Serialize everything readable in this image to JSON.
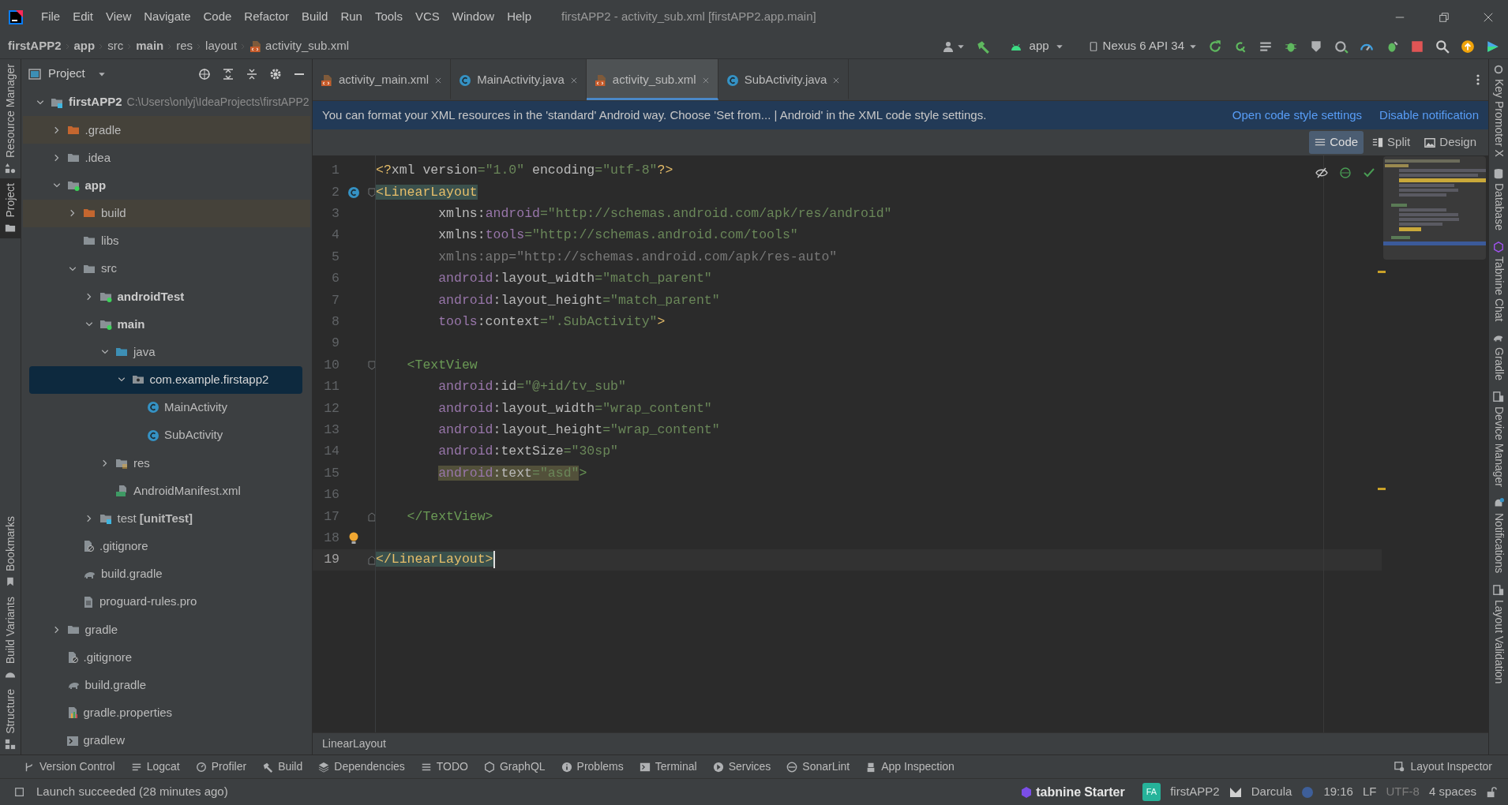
{
  "title_bar": {
    "menu": [
      "File",
      "Edit",
      "View",
      "Navigate",
      "Code",
      "Refactor",
      "Build",
      "Run",
      "Tools",
      "VCS",
      "Window",
      "Help"
    ],
    "title": "firstAPP2 - activity_sub.xml [firstAPP2.app.main]"
  },
  "navigation_bar": {
    "breadcrumbs": [
      {
        "label": "firstAPP2",
        "bold": true
      },
      {
        "label": "app",
        "bold": true
      },
      {
        "label": "src",
        "bold": false
      },
      {
        "label": "main",
        "bold": true
      },
      {
        "label": "res",
        "bold": false
      },
      {
        "label": "layout",
        "bold": false
      },
      {
        "label": "activity_sub.xml",
        "bold": false,
        "kind": "xml"
      }
    ],
    "run_config": "app",
    "device": "Nexus 6 API 34"
  },
  "left_tool_strip": {
    "top": [
      {
        "label": "Resource Manager",
        "selected": false
      },
      {
        "label": "Project",
        "selected": true
      }
    ],
    "bottom": [
      {
        "label": "Bookmarks",
        "selected": false
      },
      {
        "label": "Build Variants",
        "selected": false
      },
      {
        "label": "Structure",
        "selected": false
      }
    ]
  },
  "project_panel": {
    "title": "Project",
    "tree": [
      {
        "label": "firstAPP2",
        "kind": "project",
        "hint": "C:\\Users\\onlyj\\IdeaProjects\\firstAPP2",
        "expanded": true,
        "selected": false,
        "children": [
          {
            "label": ".gradle",
            "kind": "excluded",
            "expanded": false,
            "selected": false
          },
          {
            "label": ".idea",
            "kind": "folder",
            "expanded": false,
            "selected": false
          },
          {
            "label": "app",
            "kind": "module",
            "expanded": true,
            "selected": false,
            "children": [
              {
                "label": "build",
                "kind": "excluded",
                "expanded": false,
                "selected": false
              },
              {
                "label": "libs",
                "kind": "folder",
                "selected": false
              },
              {
                "label": "src",
                "kind": "folder",
                "expanded": true,
                "selected": false,
                "children": [
                  {
                    "label": "androidTest",
                    "kind": "module",
                    "expanded": false,
                    "selected": false
                  },
                  {
                    "label": "main",
                    "kind": "module",
                    "expanded": true,
                    "selected": false,
                    "children": [
                      {
                        "label": "java",
                        "kind": "source-root",
                        "expanded": true,
                        "selected": false,
                        "children": [
                          {
                            "label": "com.example.firstapp2",
                            "kind": "package",
                            "expanded": true,
                            "selected": true,
                            "children": [
                              {
                                "label": "MainActivity",
                                "kind": "class",
                                "selected": false
                              },
                              {
                                "label": "SubActivity",
                                "kind": "class",
                                "selected": false
                              }
                            ]
                          }
                        ]
                      },
                      {
                        "label": "res",
                        "kind": "resources",
                        "expanded": false,
                        "selected": false
                      },
                      {
                        "label": "AndroidManifest.xml",
                        "kind": "manifest",
                        "selected": false
                      }
                    ]
                  },
                  {
                    "label": "test **[unitTest]**",
                    "kind": "test-root",
                    "expanded": false,
                    "selected": false
                  }
                ]
              },
              {
                "label": ".gitignore",
                "kind": "ignore",
                "selected": false
              },
              {
                "label": "build.gradle",
                "kind": "gradle",
                "selected": false
              },
              {
                "label": "proguard-rules.pro",
                "kind": "text-file",
                "selected": false
              }
            ]
          },
          {
            "label": "gradle",
            "kind": "folder",
            "expanded": false,
            "selected": false
          },
          {
            "label": ".gitignore",
            "kind": "ignore",
            "selected": false
          },
          {
            "label": "build.gradle",
            "kind": "gradle",
            "selected": false
          },
          {
            "label": "gradle.properties",
            "kind": "properties",
            "selected": false
          },
          {
            "label": "gradlew",
            "kind": "script",
            "selected": false
          }
        ]
      }
    ]
  },
  "editor_tabs": [
    {
      "label": "activity_main.xml",
      "kind": "xml",
      "selected": false
    },
    {
      "label": "MainActivity.java",
      "kind": "java",
      "selected": false
    },
    {
      "label": "activity_sub.xml",
      "kind": "xml",
      "selected": true
    },
    {
      "label": "SubActivity.java",
      "kind": "java",
      "selected": false
    }
  ],
  "notification": {
    "text": "You can format your XML resources in the 'standard' Android way. Choose 'Set from... | Android' in the XML code style settings.",
    "actions": [
      "Open code style settings",
      "Disable notification"
    ]
  },
  "view_modes": [
    {
      "label": "Code",
      "selected": true
    },
    {
      "label": "Split",
      "selected": false
    },
    {
      "label": "Design",
      "selected": false
    }
  ],
  "code": {
    "lines": [
      {
        "number": "1",
        "kind": "root",
        "current": false,
        "tokens": [
          {
            "kind": "tag",
            "text": "<?"
          },
          {
            "kind": "attr",
            "text": "xml version"
          },
          {
            "kind": "value",
            "text": "=\"1.0\""
          },
          {
            "kind": "attr",
            "text": " encoding"
          },
          {
            "kind": "value",
            "text": "=\"utf-8\""
          },
          {
            "kind": "tag",
            "text": "?>"
          }
        ]
      },
      {
        "number": "2",
        "kind": "root",
        "current": false,
        "class_link": true,
        "fold_start": true,
        "tokens": [
          {
            "kind": "matched",
            "tokens": [
              {
                "kind": "tag",
                "text": "<LinearLayout"
              }
            ]
          }
        ]
      },
      {
        "number": "3",
        "kind": "attribute",
        "current": false,
        "tokens": [
          {
            "kind": "attr",
            "text": "xmlns:"
          },
          {
            "kind": "ns",
            "text": "android"
          },
          {
            "kind": "value",
            "text": "=\"http://schemas.android.com/apk/res/android\""
          }
        ]
      },
      {
        "number": "4",
        "kind": "attribute",
        "current": false,
        "tokens": [
          {
            "kind": "attr",
            "text": "xmlns:"
          },
          {
            "kind": "ns",
            "text": "tools"
          },
          {
            "kind": "value",
            "text": "=\"http://schemas.android.com/tools\""
          }
        ]
      },
      {
        "number": "5",
        "kind": "attribute",
        "current": false,
        "tokens": [
          {
            "kind": "dim",
            "text": "xmlns:app=\"http://schemas.android.com/apk/res-auto\""
          }
        ]
      },
      {
        "number": "6",
        "kind": "attribute",
        "current": false,
        "tokens": [
          {
            "kind": "ns",
            "text": "android"
          },
          {
            "kind": "attr",
            "text": ":layout_width"
          },
          {
            "kind": "value",
            "text": "=\"match_parent\""
          }
        ]
      },
      {
        "number": "7",
        "kind": "attribute",
        "current": false,
        "tokens": [
          {
            "kind": "ns",
            "text": "android"
          },
          {
            "kind": "attr",
            "text": ":layout_height"
          },
          {
            "kind": "value",
            "text": "=\"match_parent\""
          }
        ]
      },
      {
        "number": "8",
        "kind": "attribute",
        "current": false,
        "tokens": [
          {
            "kind": "ns",
            "text": "tools"
          },
          {
            "kind": "attr",
            "text": ":context"
          },
          {
            "kind": "value",
            "text": "=\".SubActivity\""
          },
          {
            "kind": "tag",
            "text": ">"
          }
        ]
      },
      {
        "number": "9",
        "kind": "blank",
        "current": false
      },
      {
        "number": "10",
        "kind": "child",
        "current": false,
        "fold_start": true,
        "tokens": [
          {
            "kind": "element",
            "text": "<TextView"
          }
        ]
      },
      {
        "number": "11",
        "kind": "attribute",
        "current": false,
        "tokens": [
          {
            "kind": "ns",
            "text": "android"
          },
          {
            "kind": "attr",
            "text": ":id"
          },
          {
            "kind": "value",
            "text": "=\"@+id/tv_sub\""
          }
        ]
      },
      {
        "number": "12",
        "kind": "attribute",
        "current": false,
        "tokens": [
          {
            "kind": "ns",
            "text": "android"
          },
          {
            "kind": "attr",
            "text": ":layout_width"
          },
          {
            "kind": "value",
            "text": "=\"wrap_content\""
          }
        ]
      },
      {
        "number": "13",
        "kind": "attribute",
        "current": false,
        "tokens": [
          {
            "kind": "ns",
            "text": "android"
          },
          {
            "kind": "attr",
            "text": ":layout_height"
          },
          {
            "kind": "value",
            "text": "=\"wrap_content\""
          }
        ]
      },
      {
        "number": "14",
        "kind": "attribute",
        "current": false,
        "tokens": [
          {
            "kind": "ns",
            "text": "android"
          },
          {
            "kind": "attr",
            "text": ":textSize"
          },
          {
            "kind": "value",
            "text": "=\"30sp\""
          }
        ]
      },
      {
        "number": "15",
        "kind": "attribute",
        "current": false,
        "tokens": [
          {
            "kind": "warning",
            "tokens": [
              {
                "kind": "ns",
                "text": "android"
              },
              {
                "kind": "attr",
                "text": ":text"
              },
              {
                "kind": "value",
                "text": "=\"asd\""
              }
            ]
          },
          {
            "kind": "element",
            "text": ">"
          }
        ]
      },
      {
        "number": "16",
        "kind": "blank",
        "current": false
      },
      {
        "number": "17",
        "kind": "child",
        "current": false,
        "fold_end": true,
        "tokens": [
          {
            "kind": "element",
            "text": "</TextView>"
          }
        ]
      },
      {
        "number": "18",
        "kind": "blank",
        "current": false,
        "intention_bulb": true
      },
      {
        "number": "19",
        "kind": "root",
        "current": true,
        "fold_end": true,
        "tokens": [
          {
            "kind": "matched",
            "tokens": [
              {
                "kind": "tag",
                "text": "</LinearLayout>"
              }
            ]
          }
        ]
      }
    ]
  },
  "editor_breadcrumb": "LinearLayout",
  "right_tool_strip": [
    "Key Promoter X",
    "Database",
    "Tabnine Chat",
    "Gradle",
    "Device Manager",
    "Notifications",
    "Layout Validation"
  ],
  "tool_windows": [
    "Version Control",
    "Logcat",
    "Profiler",
    "Build",
    "Dependencies",
    "TODO",
    "GraphQL",
    "Problems",
    "Terminal",
    "Services",
    "SonarLint",
    "App Inspection"
  ],
  "tool_windows_right": [
    "Layout Inspector"
  ],
  "status_bar": {
    "message": "Launch succeeded (28 minutes ago)",
    "plugin": "tabnine",
    "plan": "Starter",
    "project_badge": "FA",
    "project": "firstAPP2",
    "theme": "Darcula",
    "position": "19:16",
    "line_separator": "LF",
    "encoding": "UTF-8",
    "indent": "4 spaces"
  }
}
